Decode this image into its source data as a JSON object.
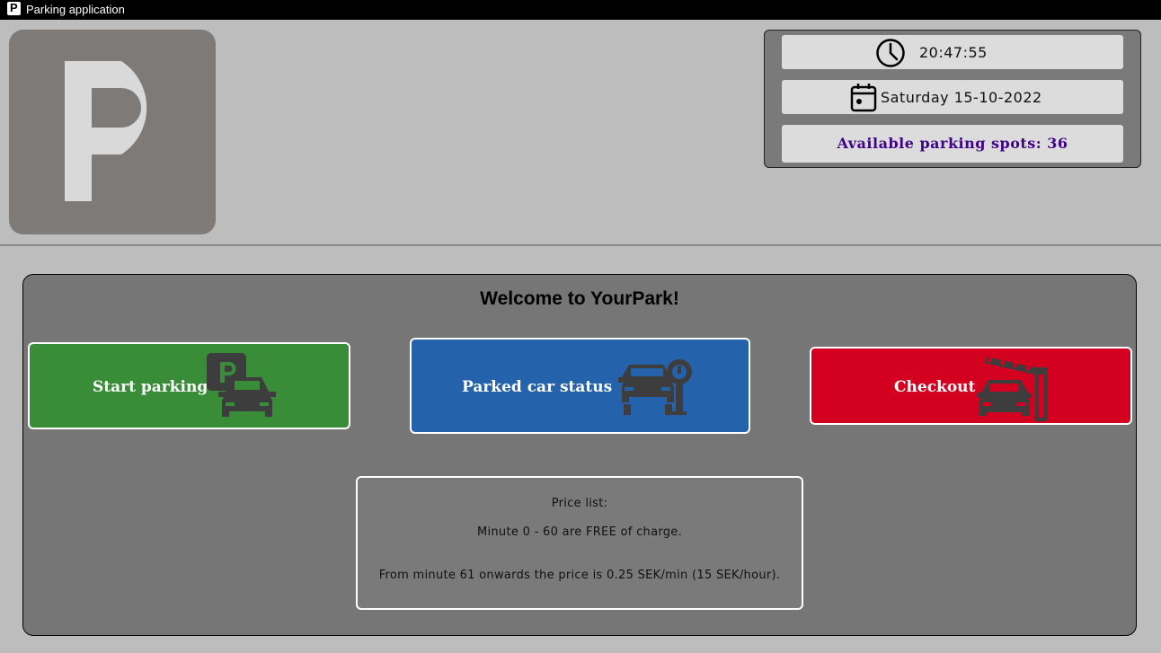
{
  "window": {
    "title": "Parking application",
    "logo_letter": "P"
  },
  "info": {
    "time": "20:47:55",
    "date": "Saturday 15-10-2022",
    "available_spots": "Available parking spots: 36",
    "spots_color": "#3f0488"
  },
  "main": {
    "welcome": "Welcome to YourPark!",
    "buttons": {
      "start": {
        "label": "Start parking",
        "icon": "parking-car-icon",
        "color": "#398d39"
      },
      "status": {
        "label": "Parked car status",
        "icon": "parking-meter-car-icon",
        "color": "#2562ac"
      },
      "checkout": {
        "label": "Checkout",
        "icon": "barrier-gate-car-icon",
        "color": "#d40020"
      }
    },
    "price_list": {
      "heading": "Price list:",
      "line1": "Minute 0 - 60 are FREE of charge.",
      "line2": "From minute 61 onwards the price is 0.25 SEK/min (15 SEK/hour)."
    }
  }
}
